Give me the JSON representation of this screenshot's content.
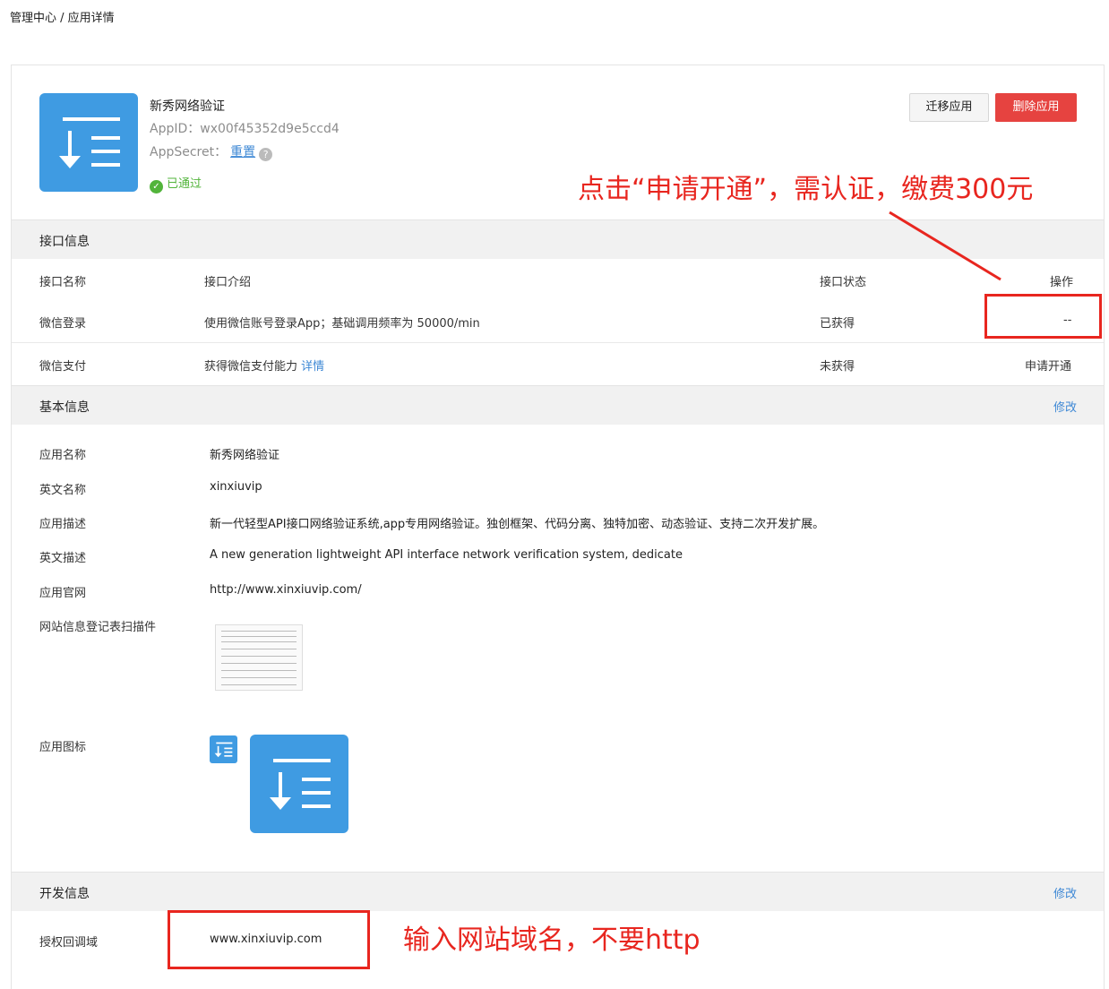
{
  "breadcrumb": {
    "text": "管理中心 / 应用详情"
  },
  "app": {
    "name": "新秀网络验证",
    "appid_label": "AppID：",
    "appid": "wx00f45352d9e5ccd4",
    "appsecret_label": "AppSecret：",
    "reset_link": "重置",
    "help": "?",
    "status": "已通过"
  },
  "actions": {
    "migrate": "迁移应用",
    "delete": "删除应用"
  },
  "interface": {
    "title": "接口信息",
    "headers": {
      "name": "接口名称",
      "intro": "接口介绍",
      "status": "接口状态",
      "op": "操作"
    },
    "rows": [
      {
        "name": "微信登录",
        "intro": "使用微信账号登录App；基础调用频率为 50000/min",
        "status": "已获得",
        "op": "--"
      },
      {
        "name": "微信支付",
        "intro": "获得微信支付能力",
        "detail": "详情",
        "status": "未获得",
        "op": "申请开通"
      }
    ]
  },
  "basic": {
    "title": "基本信息",
    "edit": "修改",
    "fields": [
      {
        "label": "应用名称",
        "value": "新秀网络验证"
      },
      {
        "label": "英文名称",
        "value": "xinxiuvip"
      },
      {
        "label": "应用描述",
        "value": "新一代轻型API接口网络验证系统,app专用网络验证。独创框架、代码分离、独特加密、动态验证、支持二次开发扩展。"
      },
      {
        "label": "英文描述",
        "value": "A new generation lightweight API interface network verification system, dedicate"
      },
      {
        "label": "应用官网",
        "value": "http://www.xinxiuvip.com/"
      },
      {
        "label": "网站信息登记表扫描件",
        "value": ""
      },
      {
        "label": "应用图标",
        "value": ""
      }
    ]
  },
  "dev": {
    "title": "开发信息",
    "edit": "修改",
    "callback_label": "授权回调域",
    "callback_value": "www.xinxiuvip.com"
  },
  "annotations": {
    "top": "点击“申请开通”，需认证，缴费300元",
    "bottom": "输入网站域名，不要http"
  },
  "colors": {
    "accent": "#3f9be2",
    "link": "#3e88d5",
    "danger": "#e64340",
    "success": "#52b43b",
    "annotation": "#e8261f"
  }
}
